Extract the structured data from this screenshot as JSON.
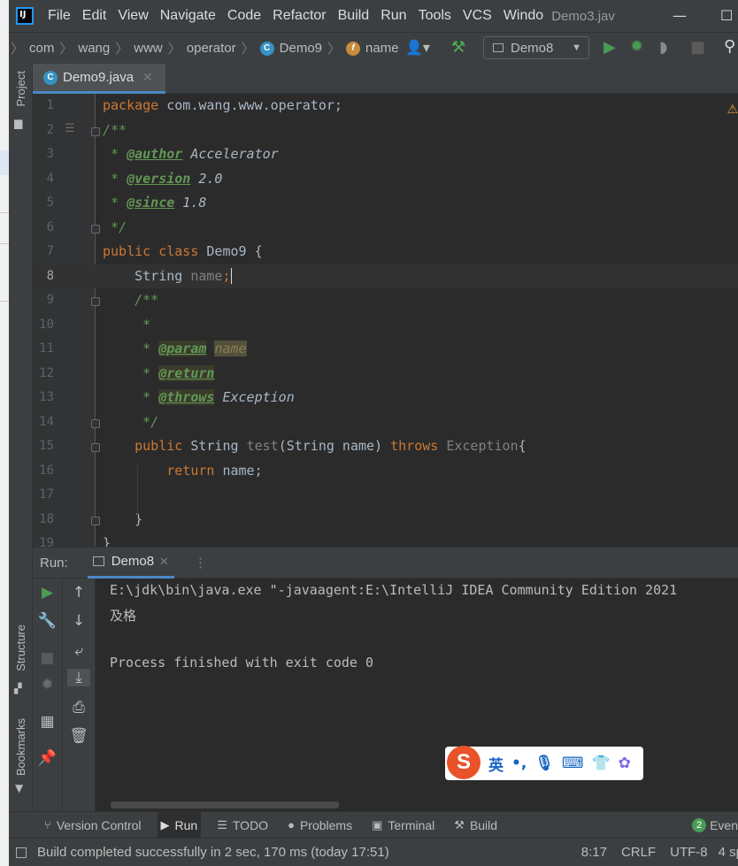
{
  "menubar": {
    "items": [
      "File",
      "Edit",
      "View",
      "Navigate",
      "Code",
      "Refactor",
      "Build",
      "Run",
      "Tools",
      "VCS",
      "Windo"
    ],
    "window_title": "Demo3.jav"
  },
  "navbar": {
    "crumbs": [
      "com",
      "wang",
      "www",
      "operator",
      "Demo9",
      "name"
    ],
    "run_config": "Demo8"
  },
  "left_tools": {
    "project": "Project",
    "structure": "Structure",
    "bookmarks": "Bookmarks"
  },
  "tab": {
    "label": "Demo9.java"
  },
  "editor": {
    "line_numbers": [
      "1",
      "2",
      "3",
      "4",
      "5",
      "6",
      "7",
      "8",
      "9",
      "10",
      "11",
      "12",
      "13",
      "14",
      "15",
      "16",
      "17",
      "18",
      "19"
    ],
    "current_line": "8"
  },
  "code": {
    "l1_kw": "package",
    "l1_rest": " com.wang.www.operator;",
    "l2": "/**",
    "l3_star": " * ",
    "l3_tag": "@author",
    "l3_val": " Accelerator",
    "l4_star": " * ",
    "l4_tag": "@version",
    "l4_val": " 2.0",
    "l5_star": " * ",
    "l5_tag": "@since",
    "l5_val": " 1.8",
    "l6": " */",
    "l7_kw": "public class",
    "l7_rest": " Demo9 {",
    "l8_type": "    String ",
    "l8_name": "name",
    "l8_semi": ";",
    "l9": "    /**",
    "l10": "     *",
    "l11_star": "     * ",
    "l11_tag": "@param",
    "l11_sp": " ",
    "l11_val": "name",
    "l12_star": "     * ",
    "l12_tag": "@return",
    "l13_star": "     * ",
    "l13_tag": "@throws",
    "l13_val": " Exception",
    "l14": "     */",
    "l15_kw": "    public",
    "l15_type": " String ",
    "l15_method": "test",
    "l15_params": "(String name) ",
    "l15_throws": "throws",
    "l15_exc": " Exception",
    "l15_brace": "{",
    "l16_kw": "        return",
    "l16_rest": " name;",
    "l17": "",
    "l18": "    }",
    "l19": "}"
  },
  "run": {
    "label": "Run:",
    "tab": "Demo8",
    "console": [
      "E:\\jdk\\bin\\java.exe \"-javaagent:E:\\IntelliJ IDEA Community Edition 2021",
      "及格",
      "",
      "Process finished with exit code 0"
    ]
  },
  "ime": {
    "lang": "英",
    "punct": "•,",
    "logo": "S"
  },
  "bottombar": {
    "items": [
      "Version Control",
      "Run",
      "TODO",
      "Problems",
      "Terminal",
      "Build"
    ],
    "event_count": "2",
    "event_label": "Even"
  },
  "statusbar": {
    "message": "Build completed successfully in 2 sec, 170 ms (today 17:51)",
    "position": "8:17",
    "line_sep": "CRLF",
    "encoding": "UTF-8",
    "indent": "4 sp"
  },
  "colors": {
    "accent": "#4a88c7",
    "run_green": "#499c54",
    "bg": "#2b2b2b"
  }
}
